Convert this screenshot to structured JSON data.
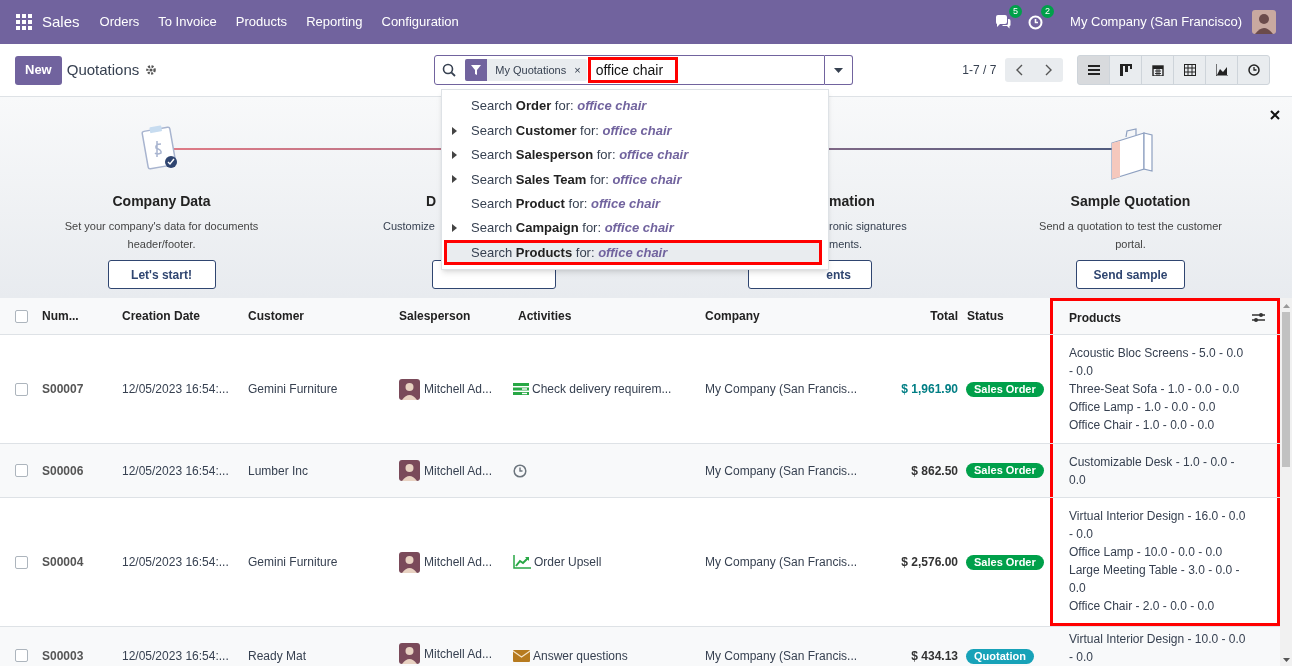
{
  "navbar": {
    "app": "Sales",
    "menu": [
      "Orders",
      "To Invoice",
      "Products",
      "Reporting",
      "Configuration"
    ],
    "messages_badge": "5",
    "activities_badge": "2",
    "company": "My Company (San Francisco)"
  },
  "control_panel": {
    "new_button": "New",
    "title": "Quotations",
    "search": {
      "facet": "My Quotations",
      "facet_remove": "×",
      "value": "office chair",
      "annotated": true
    },
    "pager": "1-7 / 7",
    "views": [
      {
        "kind": "list",
        "selected": true
      },
      {
        "kind": "kanban",
        "selected": false
      },
      {
        "kind": "calendar",
        "selected": false
      },
      {
        "kind": "pivot",
        "selected": false
      },
      {
        "kind": "graph",
        "selected": false
      },
      {
        "kind": "activity",
        "selected": false
      }
    ]
  },
  "search_dropdown": [
    {
      "prefix": "Search",
      "field": "Order",
      "middle": "for:",
      "value": "office chair",
      "expandable": false,
      "selected": false
    },
    {
      "prefix": "Search",
      "field": "Customer",
      "middle": "for:",
      "value": "office chair",
      "expandable": true,
      "selected": false
    },
    {
      "prefix": "Search",
      "field": "Salesperson",
      "middle": "for:",
      "value": "office chair",
      "expandable": true,
      "selected": false
    },
    {
      "prefix": "Search",
      "field": "Sales Team",
      "middle": "for:",
      "value": "office chair",
      "expandable": true,
      "selected": false
    },
    {
      "prefix": "Search",
      "field": "Product",
      "middle": "for:",
      "value": "office chair",
      "expandable": false,
      "selected": false
    },
    {
      "prefix": "Search",
      "field": "Campaign",
      "middle": "for:",
      "value": "office chair",
      "expandable": true,
      "selected": false
    },
    {
      "prefix": "Search",
      "field": "Products",
      "middle": "for:",
      "value": "office chair",
      "expandable": false,
      "selected": true
    }
  ],
  "onboarding": {
    "steps": [
      {
        "kind": "full",
        "title": "Company Data",
        "description": [
          "Set your company's data for documents",
          "header/footer."
        ],
        "button": "Let's start!"
      },
      {
        "kind": "hidden_right",
        "title": "D",
        "description": [
          "Customize"
        ]
      },
      {
        "kind": "hidden_left",
        "title": "mation",
        "description": [
          "ronic signatures",
          "ments."
        ],
        "button": "ents"
      },
      {
        "kind": "full",
        "title": "Sample Quotation",
        "description": [
          "Send a quotation to test the customer",
          "portal."
        ],
        "button": "Send sample"
      }
    ]
  },
  "table": {
    "all_checked": false,
    "columns": [
      {
        "label": "Num...",
        "kind": "text",
        "annotated": false
      },
      {
        "label": "Creation Date",
        "kind": "text",
        "annotated": false
      },
      {
        "label": "Customer",
        "kind": "text",
        "annotated": false
      },
      {
        "label": "Salesperson",
        "kind": "text",
        "annotated": false
      },
      {
        "label": "Activities",
        "kind": "text",
        "annotated": false
      },
      {
        "label": "Company",
        "kind": "text",
        "annotated": false
      },
      {
        "label": "Total",
        "kind": "amount",
        "annotated": false
      },
      {
        "label": "Status",
        "kind": "text",
        "annotated": false
      },
      {
        "label": "Products",
        "kind": "text",
        "annotated": true
      }
    ],
    "rows": [
      {
        "checked": false,
        "number": "S00007",
        "date": "12/05/2023 16:54:...",
        "customer": "Gemini Furniture",
        "salesperson": "Mitchell Ad...",
        "activity": {
          "kind": "todo",
          "text": "Check delivery requirem..."
        },
        "company": "My Company (San Francis...",
        "total": "$ 1,961.90",
        "total_highlighted": true,
        "status": {
          "label": "Sales Order",
          "color": "#00a04a"
        },
        "products": [
          "Acoustic Bloc Screens - 5.0 - 0.0 - 0.0",
          "Three-Seat Sofa - 1.0 - 0.0 - 0.0",
          "Office Lamp - 1.0 - 0.0 - 0.0",
          "Office Chair - 1.0 - 0.0 - 0.0"
        ],
        "products_annotated": true
      },
      {
        "checked": false,
        "number": "S00006",
        "date": "12/05/2023 16:54:...",
        "customer": "Lumber Inc",
        "salesperson": "Mitchell Ad...",
        "activity": {
          "kind": "none"
        },
        "company": "My Company (San Francis...",
        "total": "$ 862.50",
        "total_highlighted": false,
        "status": {
          "label": "Sales Order",
          "color": "#00a04a"
        },
        "products": [
          "Customizable Desk - 1.0 - 0.0 - 0.0"
        ],
        "products_annotated": true
      },
      {
        "checked": false,
        "number": "S00004",
        "date": "12/05/2023 16:54:...",
        "customer": "Gemini Furniture",
        "salesperson": "Mitchell Ad...",
        "activity": {
          "kind": "upsell",
          "text": "Order Upsell"
        },
        "company": "My Company (San Francis...",
        "total": "$ 2,576.00",
        "total_highlighted": false,
        "status": {
          "label": "Sales Order",
          "color": "#00a04a"
        },
        "products": [
          "Virtual Interior Design - 16.0 - 0.0 - 0.0",
          "Office Lamp - 10.0 - 0.0 - 0.0",
          "Large Meeting Table - 3.0 - 0.0 - 0.0",
          "Office Chair - 2.0 - 0.0 - 0.0"
        ],
        "products_annotated": true
      },
      {
        "checked": false,
        "number": "S00003",
        "date": "12/05/2023 16:54:...",
        "customer": "Ready Mat",
        "salesperson": "Mitchell Ad...",
        "activity": {
          "kind": "email",
          "text": "Answer questions"
        },
        "company": "My Company (San Francis...",
        "total": "$ 434.13",
        "total_highlighted": false,
        "status": {
          "label": "Quotation",
          "color": "#17a2b8"
        },
        "products": [
          "Virtual Interior Design - 10.0 - 0.0 - 0.0"
        ],
        "products_annotated": false
      }
    ]
  }
}
